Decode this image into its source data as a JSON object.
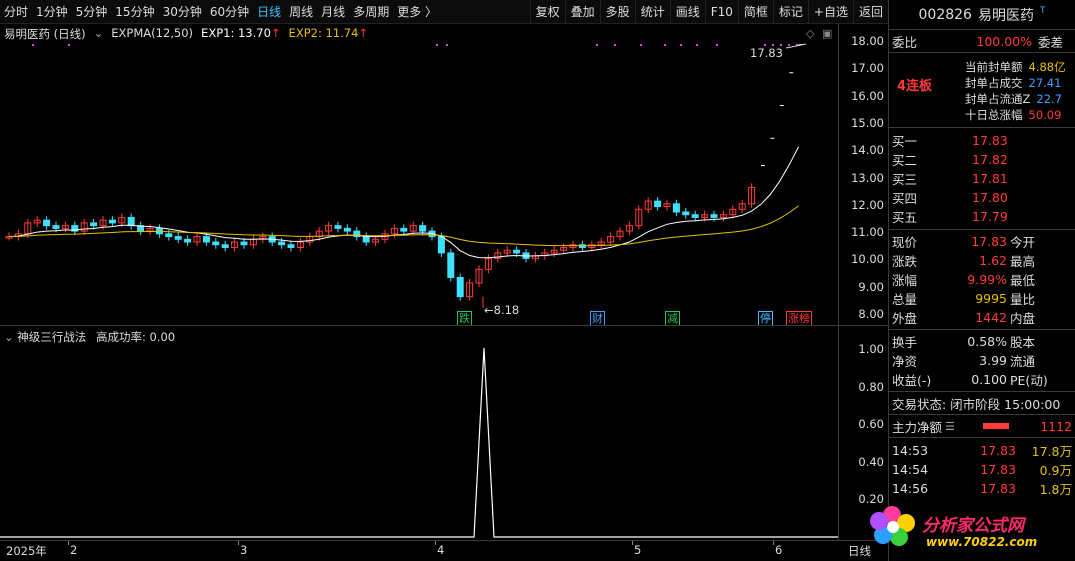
{
  "toolbar": {
    "periods": [
      "分时",
      "1分钟",
      "5分钟",
      "15分钟",
      "30分钟",
      "60分钟",
      "日线",
      "周线",
      "月线",
      "多周期",
      "更多 〉"
    ],
    "active_period": "日线",
    "tools": [
      "复权",
      "叠加",
      "多股",
      "统计",
      "画线",
      "F10",
      "简框",
      "标记",
      "+自选",
      "返回"
    ]
  },
  "main_chart": {
    "stock_title": "易明医药 (日线)",
    "indicator": "EXPMA(12,50)",
    "exp1_label": "EXP1: 13.70",
    "exp1_arrow": "↑",
    "exp2_label": "EXP2: 11.74",
    "exp2_arrow": "↑",
    "high_label": "17.83",
    "low_label": "←8.18",
    "y_ticks": [
      "18.00",
      "17.00",
      "16.00",
      "15.00",
      "14.00",
      "13.00",
      "12.00",
      "11.00",
      "10.00",
      "9.00",
      "8.00"
    ],
    "markers": [
      {
        "text": "跌",
        "color": "#22c55e"
      },
      {
        "text": "财",
        "color": "#41a0ff"
      },
      {
        "text": "减",
        "color": "#22c55e"
      },
      {
        "text": "停",
        "color": "#41c0ff"
      },
      {
        "text": "涨榜",
        "color": "#ff3b3b"
      }
    ],
    "colors": {
      "up": "#ff3b3b",
      "down": "#3ee0ff",
      "exp1": "#ffffff",
      "exp2": "#e8c000",
      "dots": "#e040e0"
    }
  },
  "sub_chart": {
    "title": "神级三行战法",
    "rate_label": "高成功率: 0.00",
    "y_ticks": [
      "1.00",
      "0.80",
      "0.60",
      "0.40",
      "0.20"
    ]
  },
  "xaxis": {
    "labels": [
      "2025年",
      "2",
      "3",
      "4",
      "5",
      "6"
    ],
    "corner": "日线"
  },
  "panel": {
    "code": "002826",
    "name": "易明医药",
    "name_mark": "T",
    "weibi_label": "委比",
    "weibi_value": "100.00%",
    "weicha_label": "委差",
    "streak": "4连板",
    "seal_info": [
      {
        "label": "当前封单额",
        "value": "4.88亿"
      },
      {
        "label": "封单占成交",
        "value": "27.41"
      },
      {
        "label": "封单占流通Z",
        "value": "22.7"
      },
      {
        "label": "十日总涨幅",
        "value": "50.09"
      }
    ],
    "bids": [
      {
        "label": "买一",
        "price": "17.83"
      },
      {
        "label": "买二",
        "price": "17.82"
      },
      {
        "label": "买三",
        "price": "17.81"
      },
      {
        "label": "买四",
        "price": "17.80"
      },
      {
        "label": "买五",
        "price": "17.79"
      }
    ],
    "quote": [
      {
        "l1": "现价",
        "v1": "17.83",
        "l2": "今开"
      },
      {
        "l1": "涨跌",
        "v1": "1.62",
        "l2": "最高"
      },
      {
        "l1": "涨幅",
        "v1": "9.99%",
        "l2": "最低"
      },
      {
        "l1": "总量",
        "v1": "9995",
        "l2": "量比"
      },
      {
        "l1": "外盘",
        "v1": "1442",
        "l2": "内盘"
      }
    ],
    "fund": [
      {
        "l1": "换手",
        "v1": "0.58%",
        "l2": "股本"
      },
      {
        "l1": "净资",
        "v1": "3.99",
        "l2": "流通"
      },
      {
        "l1": "收益(-)",
        "v1": "0.100",
        "l2": "PE(动)"
      }
    ],
    "trade_status": "交易状态: 闭市阶段 15:00:00",
    "main_flow_label": "主力净额",
    "main_flow_value": "1112",
    "ticks": [
      {
        "time": "14:53",
        "price": "17.83",
        "vol": "17.8万"
      },
      {
        "time": "14:54",
        "price": "17.83",
        "vol": "0.9万"
      },
      {
        "time": "14:56",
        "price": "17.83",
        "vol": "1.8万"
      }
    ]
  },
  "watermark": {
    "line1": "分析家公式网",
    "line2": "www.70822.com"
  }
}
